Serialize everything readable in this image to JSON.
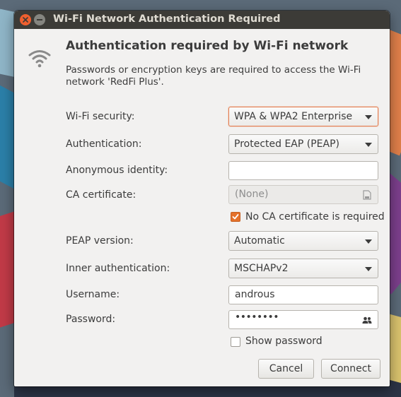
{
  "window": {
    "title": "Wi-Fi Network Authentication Required"
  },
  "dialog": {
    "heading": "Authentication required by Wi-Fi network",
    "description": "Passwords or encryption keys are required to access the Wi-Fi network 'RedFi Plus'."
  },
  "form": {
    "wifi_security": {
      "label": "Wi-Fi security:",
      "value": "WPA & WPA2 Enterprise"
    },
    "authentication": {
      "label": "Authentication:",
      "value": "Protected EAP (PEAP)"
    },
    "anonymous_identity": {
      "label": "Anonymous identity:",
      "value": ""
    },
    "ca_certificate": {
      "label": "CA certificate:",
      "value": "(None)"
    },
    "no_ca_required": {
      "label": "No CA certificate is required",
      "checked": true
    },
    "peap_version": {
      "label": "PEAP version:",
      "value": "Automatic"
    },
    "inner_authentication": {
      "label": "Inner authentication:",
      "value": "MSCHAPv2"
    },
    "username": {
      "label": "Username:",
      "value": "androus"
    },
    "password": {
      "label": "Password:",
      "value": "••••••••"
    },
    "show_password": {
      "label": "Show password",
      "checked": false
    }
  },
  "buttons": {
    "cancel": "Cancel",
    "connect": "Connect"
  },
  "colors": {
    "accent": "#e4712a",
    "titlebar": "#3c3b37",
    "close_button": "#ef5f2f"
  }
}
